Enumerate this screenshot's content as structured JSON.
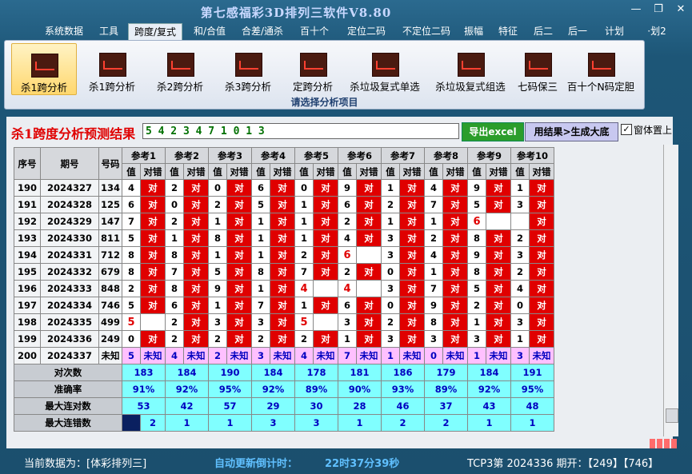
{
  "app": {
    "title": "第七感福彩3D排列三软件V8.80",
    "controls": {
      "minimize": "—",
      "restore": "❐",
      "close": "✕"
    }
  },
  "menu": [
    "系统数据",
    "工具",
    "跨度/复式",
    "和/合值",
    "合差/通杀",
    "百十个",
    "定位二码",
    "不定位二码",
    "振幅",
    "特征",
    "后二",
    "后一",
    "计划",
    "·划2"
  ],
  "menu_active": "跨度/复式",
  "ribbon": {
    "buttons": [
      "杀1跨分析",
      "杀1跨分析",
      "杀2跨分析",
      "杀3跨分析",
      "定跨分析",
      "杀垃圾复式单选",
      "杀垃圾复式组选",
      "七码保三",
      "百十个N码定胆"
    ],
    "icon": "chart-icon",
    "caption": "请选择分析项目"
  },
  "result": {
    "title": "杀1跨度分析预测结果",
    "value": "5 4 2 3 4 7 1 0 1 3",
    "excel_button": "导出excel",
    "generate_button": "用结果>生成大底",
    "pin_checked": true,
    "pin_mark": "✓",
    "pin_label": "窗体置上"
  },
  "table": {
    "headers": {
      "seq": "序号",
      "issue": "期号",
      "number": "号码",
      "refs": [
        "参考1",
        "参考2",
        "参考3",
        "参考4",
        "参考5",
        "参考6",
        "参考7",
        "参考8",
        "参考9",
        "参考10"
      ],
      "value": "值",
      "check": "对错"
    },
    "rows": [
      {
        "seq": "190",
        "issue": "2024327",
        "num": "134",
        "vals": [
          "4",
          "2",
          "0",
          "6",
          "0",
          "9",
          "1",
          "4",
          "9",
          "1"
        ],
        "ok": [
          1,
          1,
          1,
          1,
          1,
          1,
          1,
          1,
          1,
          1
        ]
      },
      {
        "seq": "191",
        "issue": "2024328",
        "num": "125",
        "vals": [
          "6",
          "0",
          "2",
          "5",
          "1",
          "6",
          "2",
          "7",
          "5",
          "3"
        ],
        "ok": [
          1,
          1,
          1,
          1,
          1,
          1,
          1,
          1,
          1,
          1
        ]
      },
      {
        "seq": "192",
        "issue": "2024329",
        "num": "147",
        "vals": [
          "7",
          "2",
          "1",
          "1",
          "1",
          "2",
          "1",
          "1",
          "6",
          ""
        ],
        "ok": [
          1,
          1,
          1,
          1,
          1,
          1,
          1,
          1,
          0,
          1
        ]
      },
      {
        "seq": "193",
        "issue": "2024330",
        "num": "811",
        "vals": [
          "5",
          "1",
          "8",
          "1",
          "1",
          "4",
          "3",
          "2",
          "8",
          "2"
        ],
        "ok": [
          1,
          1,
          1,
          1,
          1,
          1,
          1,
          1,
          1,
          1
        ]
      },
      {
        "seq": "194",
        "issue": "2024331",
        "num": "712",
        "vals": [
          "8",
          "8",
          "1",
          "1",
          "2",
          "6",
          "3",
          "4",
          "9",
          "3"
        ],
        "ok": [
          1,
          1,
          1,
          1,
          1,
          0,
          1,
          1,
          1,
          1
        ]
      },
      {
        "seq": "195",
        "issue": "2024332",
        "num": "679",
        "vals": [
          "8",
          "7",
          "5",
          "8",
          "7",
          "2",
          "0",
          "1",
          "8",
          "2"
        ],
        "ok": [
          1,
          1,
          1,
          1,
          1,
          1,
          1,
          1,
          1,
          1
        ]
      },
      {
        "seq": "196",
        "issue": "2024333",
        "num": "848",
        "vals": [
          "2",
          "8",
          "9",
          "1",
          "4",
          "4",
          "3",
          "7",
          "5",
          "4"
        ],
        "ok": [
          1,
          1,
          1,
          1,
          0,
          0,
          1,
          1,
          1,
          1
        ]
      },
      {
        "seq": "197",
        "issue": "2024334",
        "num": "746",
        "vals": [
          "5",
          "6",
          "1",
          "7",
          "1",
          "6",
          "0",
          "9",
          "2",
          "0"
        ],
        "ok": [
          1,
          1,
          1,
          1,
          1,
          1,
          1,
          1,
          1,
          1
        ]
      },
      {
        "seq": "198",
        "issue": "2024335",
        "num": "499",
        "vals": [
          "5",
          "2",
          "3",
          "3",
          "5",
          "3",
          "2",
          "8",
          "1",
          "3"
        ],
        "ok": [
          0,
          1,
          1,
          1,
          0,
          1,
          1,
          1,
          1,
          1
        ]
      },
      {
        "seq": "199",
        "issue": "2024336",
        "num": "249",
        "vals": [
          "0",
          "2",
          "2",
          "2",
          "2",
          "1",
          "3",
          "3",
          "3",
          "1"
        ],
        "ok": [
          1,
          1,
          1,
          1,
          1,
          1,
          1,
          1,
          1,
          1
        ]
      }
    ],
    "unknown_row": {
      "seq": "200",
      "issue": "2024337",
      "num": "未知",
      "vals": [
        "5",
        "4",
        "2",
        "3",
        "4",
        "7",
        "1",
        "0",
        "1",
        "3"
      ],
      "mark": "未知"
    },
    "stats": [
      {
        "label": "对次数",
        "values": [
          "183",
          "184",
          "190",
          "184",
          "178",
          "181",
          "186",
          "179",
          "184",
          "191"
        ]
      },
      {
        "label": "准确率",
        "values": [
          "91%",
          "92%",
          "95%",
          "92%",
          "89%",
          "90%",
          "93%",
          "89%",
          "92%",
          "95%"
        ]
      },
      {
        "label": "最大连对数",
        "values": [
          "53",
          "42",
          "57",
          "29",
          "30",
          "28",
          "46",
          "37",
          "43",
          "48"
        ]
      },
      {
        "label": "最大连错数",
        "values": [
          "2",
          "1",
          "1",
          "3",
          "3",
          "1",
          "2",
          "2",
          "1",
          "1"
        ]
      }
    ],
    "ok_mark": "对"
  },
  "status": {
    "current_label": "当前数据为：[体彩排列三]",
    "countdown_label": "自动更新倒计时：",
    "countdown_value": "22时37分39秒",
    "draw_info": "TCP3第 2024336 期开：【249】【746】"
  },
  "colors": {
    "hit": "#e00000",
    "unknown": "#ffc0ff",
    "stats": "#80ffff",
    "accent": "#0000c0"
  }
}
